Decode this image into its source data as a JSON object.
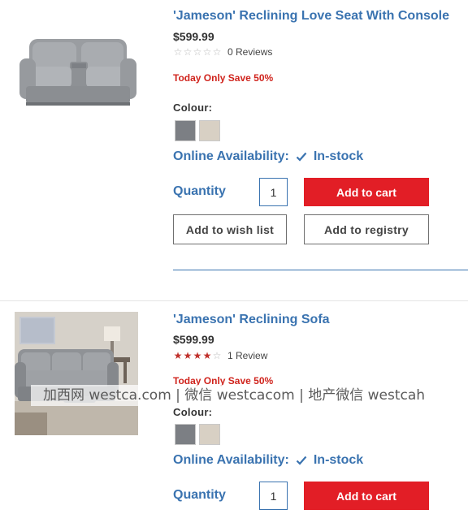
{
  "products": [
    {
      "title": "'Jameson' Reclining Love Seat With Console",
      "price": "$599.99",
      "rating_stars": 0,
      "reviews_label": "0 Reviews",
      "promo": "Today Only Save 50%",
      "colour_label": "Colour:",
      "swatches": [
        "#7c7f84",
        "#d8d0c4"
      ],
      "availability_label": "Online Availability:",
      "availability_status": "In-stock",
      "quantity_label": "Quantity",
      "quantity_value": "1",
      "add_to_cart": "Add to cart",
      "add_to_wish_list": "Add to wish list",
      "add_to_registry": "Add to registry"
    },
    {
      "title": "'Jameson' Reclining Sofa",
      "price": "$599.99",
      "rating_stars": 4,
      "reviews_label": "1 Review",
      "promo": "Today Only Save 50%",
      "colour_label": "Colour:",
      "swatches": [
        "#7c7f84",
        "#d8d0c4"
      ],
      "availability_label": "Online Availability:",
      "availability_status": "In-stock",
      "quantity_label": "Quantity",
      "quantity_value": "1",
      "add_to_cart": "Add to cart"
    }
  ],
  "watermark": "加西网 westca.com | 微信 westcacom | 地产微信 westcahouse",
  "colors": {
    "brand_blue": "#3a73b0",
    "cart_red": "#e21e26",
    "promo_red": "#d0241d",
    "star_red": "#c0302b"
  }
}
